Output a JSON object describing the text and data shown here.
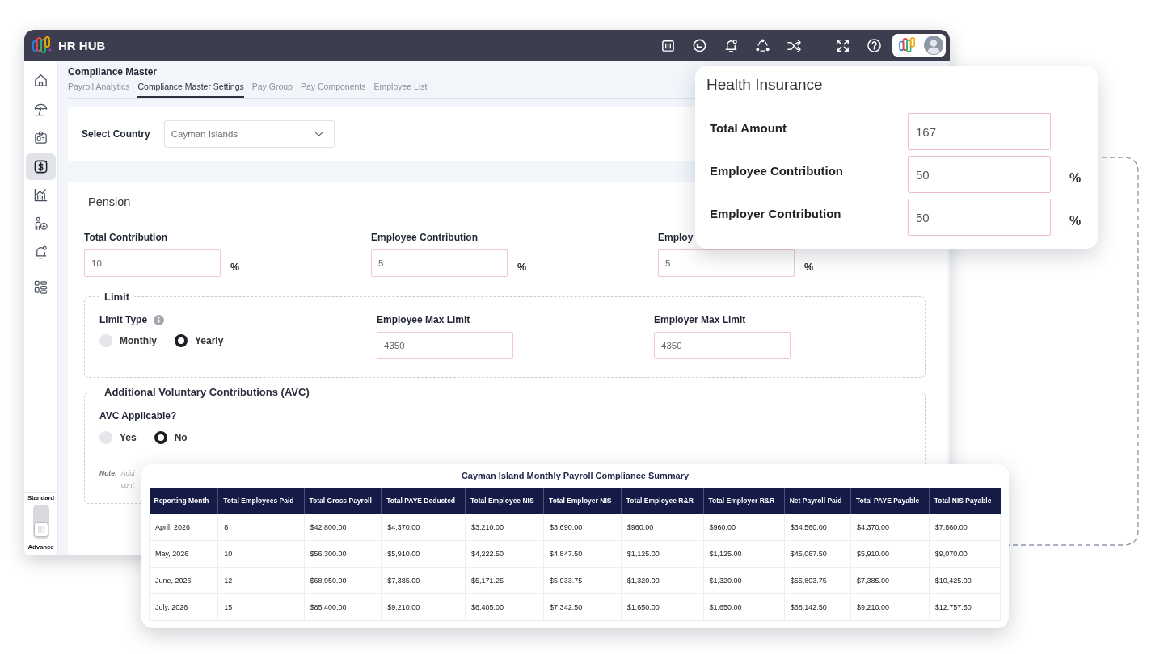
{
  "app": {
    "brand": "HR HUB"
  },
  "sidebar": {
    "items": [
      {
        "selected": false
      },
      {
        "selected": false
      },
      {
        "selected": false
      },
      {
        "selected": true
      },
      {
        "selected": false
      },
      {
        "selected": false
      },
      {
        "selected": false
      },
      {
        "selected": false
      }
    ],
    "mode_toggle": {
      "labels": [
        "Standard",
        "Advance"
      ],
      "on": true
    }
  },
  "page": {
    "title": "Compliance Master",
    "tabs": [
      {
        "label": "Payroll Analytics",
        "selected": false
      },
      {
        "label": "Compliance Master Settings",
        "selected": true
      },
      {
        "label": "Pay Group",
        "selected": false
      },
      {
        "label": "Pay Components",
        "selected": false
      },
      {
        "label": "Employee List",
        "selected": false
      }
    ]
  },
  "country": {
    "label": "Select Country",
    "value": "Cayman Islands"
  },
  "pension": {
    "title": "Pension",
    "fields": [
      {
        "label": "Total Contribution",
        "value": "10",
        "unit": "%"
      },
      {
        "label": "Employee Contribution",
        "value": "5",
        "unit": "%"
      },
      {
        "label": "Employ",
        "value": "5",
        "unit": "%"
      }
    ],
    "limit": {
      "title": "Limit",
      "type_label": "Limit Type",
      "options": [
        {
          "label": "Monthly",
          "selected": false
        },
        {
          "label": "Yearly",
          "selected": true
        }
      ],
      "fields": [
        {
          "label": "Employee Max Limit",
          "value": "4350"
        },
        {
          "label": "Employer Max Limit",
          "value": "4350"
        }
      ]
    },
    "avc": {
      "title": "Additional Voluntary Contributions (AVC)",
      "question": "AVC Applicable?",
      "options": [
        {
          "label": "Yes",
          "selected": false
        },
        {
          "label": "No",
          "selected": true
        }
      ],
      "note": {
        "label": "Note:",
        "lines": [
          "Addi",
          "cont"
        ]
      }
    }
  },
  "health_insurance": {
    "title": "Health Insurance",
    "fields": [
      {
        "label": "Total Amount",
        "value": "167"
      },
      {
        "label": "Employee Contribution",
        "value": "50",
        "unit": "%"
      },
      {
        "label": "Employer Contribution",
        "value": "50",
        "unit": "%"
      }
    ]
  },
  "summary_table": {
    "title": "Cayman Island Monthly Payroll Compliance Summary",
    "columns": [
      "Reporting Month",
      "Total Employees Paid",
      "Total Gross Payroll",
      "Total PAYE Deducted",
      "Total Employee NIS",
      "Total Employer NIS",
      "Total Employee R&R",
      "Total Employer R&R",
      "Net Payroll Paid",
      "Total PAYE Payable",
      "Total NIS Payable"
    ],
    "rows": [
      [
        "April, 2026",
        "8",
        "$42,800.00",
        "$4,370.00",
        "$3,210.00",
        "$3,690.00",
        "$960.00",
        "$960.00",
        "$34,560.00",
        "$4,370.00",
        "$7,860.00"
      ],
      [
        "May, 2026",
        "10",
        "$56,300.00",
        "$5,910.00",
        "$4,222.50",
        "$4,847.50",
        "$1,125.00",
        "$1,125.00",
        "$45,067.50",
        "$5,910.00",
        "$9,070.00"
      ],
      [
        "June, 2026",
        "12",
        "$68,950.00",
        "$7,385.00",
        "$5,171.25",
        "$5,933.75",
        "$1,320.00",
        "$1,320.00",
        "$55,803.75",
        "$7,385.00",
        "$10,425.00"
      ],
      [
        "July, 2026",
        "15",
        "$85,400.00",
        "$9,210.00",
        "$6,405.00",
        "$7,342.50",
        "$1,650.00",
        "$1,650.00",
        "$68,142.50",
        "$9,210.00",
        "$12,757.50"
      ]
    ]
  }
}
